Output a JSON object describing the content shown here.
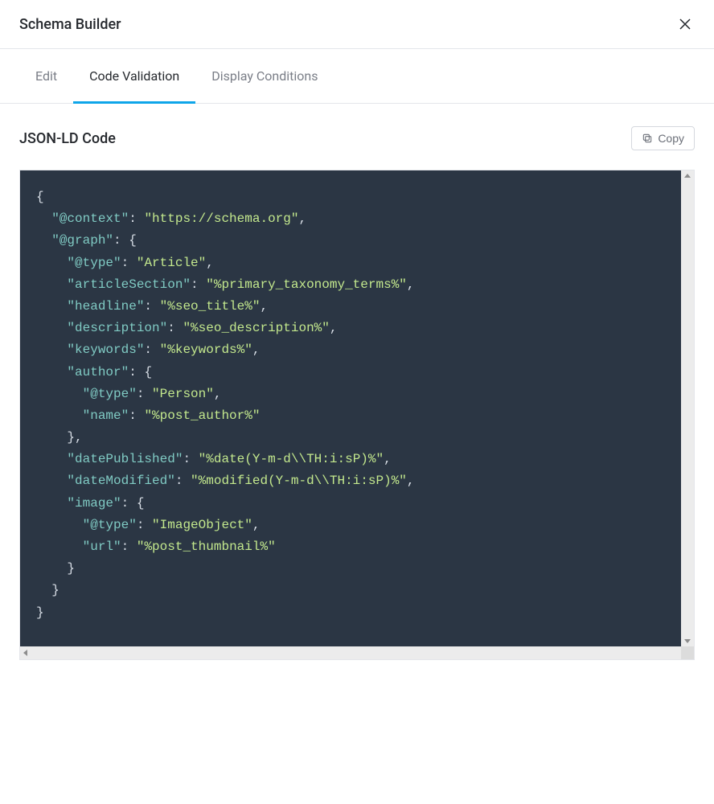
{
  "header": {
    "title": "Schema Builder"
  },
  "tabs": {
    "edit": "Edit",
    "validation": "Code Validation",
    "conditions": "Display Conditions",
    "active": "validation"
  },
  "section": {
    "title": "JSON-LD Code",
    "copy_label": "Copy"
  },
  "code": {
    "context_key": "\"@context\"",
    "context_val": "\"https://schema.org\"",
    "graph_key": "\"@graph\"",
    "type_key": "\"@type\"",
    "type_val": "\"Article\"",
    "articleSection_key": "\"articleSection\"",
    "articleSection_val": "\"%primary_taxonomy_terms%\"",
    "headline_key": "\"headline\"",
    "headline_val": "\"%seo_title%\"",
    "description_key": "\"description\"",
    "description_val": "\"%seo_description%\"",
    "keywords_key": "\"keywords\"",
    "keywords_val": "\"%keywords%\"",
    "author_key": "\"author\"",
    "author_type_key": "\"@type\"",
    "author_type_val": "\"Person\"",
    "author_name_key": "\"name\"",
    "author_name_val": "\"%post_author%\"",
    "datePublished_key": "\"datePublished\"",
    "datePublished_val": "\"%date(Y-m-d\\\\TH:i:sP)%\"",
    "dateModified_key": "\"dateModified\"",
    "dateModified_val": "\"%modified(Y-m-d\\\\TH:i:sP)%\"",
    "image_key": "\"image\"",
    "image_type_key": "\"@type\"",
    "image_type_val": "\"ImageObject\"",
    "image_url_key": "\"url\"",
    "image_url_val": "\"%post_thumbnail%\""
  }
}
